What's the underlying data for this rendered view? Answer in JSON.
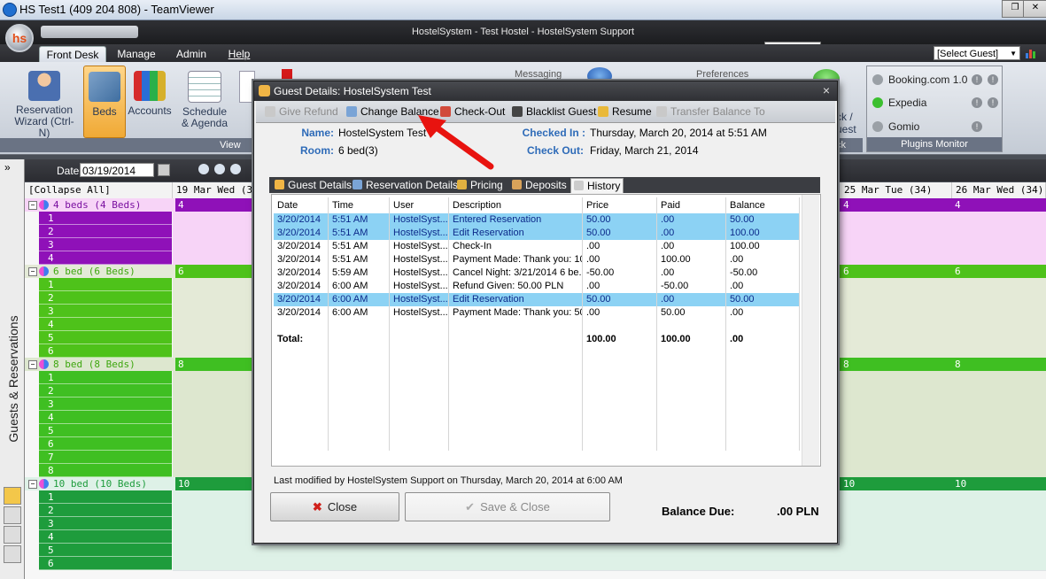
{
  "teamviewer": {
    "title": "HS Test1 (409 204 808) - TeamViewer"
  },
  "app": {
    "title": "HostelSystem - Test Hostel - HostelSystem Support",
    "logo": "hs"
  },
  "menu": {
    "tabs": [
      {
        "label": "Front Desk"
      },
      {
        "label": "Manage"
      },
      {
        "label": "Admin"
      },
      {
        "label": "Help"
      }
    ],
    "select_guest": "[Select Guest]"
  },
  "ribbon": {
    "buttons": [
      {
        "label": "Reservation\nWizard (Ctrl-N)",
        "icon": "person-add-icon"
      },
      {
        "label": "Beds",
        "icon": "beds-icon"
      },
      {
        "label": "Accounts",
        "icon": "binders-icon"
      },
      {
        "label": "Schedule\n& Agenda",
        "icon": "calendar-icon"
      }
    ],
    "group_view": "View",
    "partial": {
      "messaging": "Messaging",
      "preferences": "Preferences",
      "checkout_fragment": "ck /",
      "guest_fragment": "uest",
      "ck_fragment": "ck"
    },
    "plugins_title": "Plugins Monitor",
    "plugins": [
      {
        "name": "Booking.com 1.0",
        "status_color": "#9aa0a6"
      },
      {
        "name": "Expedia",
        "status_color": "#3bbf2f"
      },
      {
        "name": "Gomio",
        "status_color": "#9aa0a6"
      }
    ]
  },
  "sidebar": {
    "label": "Guests & Reservations"
  },
  "datebar": {
    "label": "Date:",
    "value": "03/19/2014"
  },
  "grid": {
    "collapse_label": "[Collapse All]",
    "columns": [
      "19 Mar Wed (34)",
      "25 Mar Tue (34)",
      "26 Mar Wed (34)"
    ],
    "groups": [
      {
        "label": "4 beds (4 Beds)",
        "count": "4",
        "beds": [
          "1",
          "2",
          "3",
          "4"
        ],
        "color": "#8f11b8",
        "cell_color": "#f7d4f7",
        "text_color": "#7a0fa0"
      },
      {
        "label": "6 bed (6 Beds)",
        "count": "6",
        "beds": [
          "1",
          "2",
          "3",
          "4",
          "5",
          "6"
        ],
        "color": "#4ec21a",
        "cell_color": "#e4ead7",
        "text_color": "#3ea70f"
      },
      {
        "label": "8 bed (8 Beds)",
        "count": "8",
        "beds": [
          "1",
          "2",
          "3",
          "4",
          "5",
          "6",
          "7",
          "8"
        ],
        "color": "#3fbf22",
        "cell_color": "#dde7cf",
        "text_color": "#3ea70f"
      },
      {
        "label": "10 bed (10 Beds)",
        "count": "10",
        "beds": [
          "1",
          "2",
          "3",
          "4",
          "5",
          "6"
        ],
        "color": "#1e9c3c",
        "cell_color": "#def1e7",
        "text_color": "#1e9c3c"
      }
    ]
  },
  "dialog": {
    "title": "Guest Details: HostelSystem Test",
    "toolbar": {
      "give_refund": "Give Refund",
      "change_balance": "Change Balance",
      "check_out": "Check-Out",
      "blacklist": "Blacklist Guest",
      "resume": "Resume",
      "transfer": "Transfer Balance To"
    },
    "info": {
      "name_label": "Name:",
      "name_value": "HostelSystem Test",
      "room_label": "Room:",
      "room_value": "6 bed(3)",
      "checkin_label": "Checked In :",
      "checkin_value": "Thursday, March 20, 2014 at 5:51 AM",
      "checkout_label": "Check Out:",
      "checkout_value": "Friday, March 21, 2014"
    },
    "tabs": {
      "guest_details": "Guest Details",
      "reservation_details": "Reservation Details",
      "pricing": "Pricing",
      "deposits": "Deposits",
      "history": "History"
    },
    "history": {
      "headers": [
        "Date",
        "Time",
        "User",
        "Description",
        "Price",
        "Paid",
        "Balance"
      ],
      "rows": [
        {
          "date": "3/20/2014",
          "time": "5:51 AM",
          "user": "HostelSyst...",
          "desc": "Entered Reservation",
          "price": "50.00",
          "paid": ".00",
          "balance": "50.00",
          "selected": true
        },
        {
          "date": "3/20/2014",
          "time": "5:51 AM",
          "user": "HostelSyst...",
          "desc": "Edit Reservation",
          "price": "50.00",
          "paid": ".00",
          "balance": "100.00",
          "selected": true
        },
        {
          "date": "3/20/2014",
          "time": "5:51 AM",
          "user": "HostelSyst...",
          "desc": "Check-In",
          "price": ".00",
          "paid": ".00",
          "balance": "100.00",
          "selected": false
        },
        {
          "date": "3/20/2014",
          "time": "5:51 AM",
          "user": "HostelSyst...",
          "desc": "Payment Made: Thank you: 10...",
          "price": ".00",
          "paid": "100.00",
          "balance": ".00",
          "selected": false
        },
        {
          "date": "3/20/2014",
          "time": "5:59 AM",
          "user": "HostelSyst...",
          "desc": "Cancel Night: 3/21/2014 6 be...",
          "price": "-50.00",
          "paid": ".00",
          "balance": "-50.00",
          "selected": false
        },
        {
          "date": "3/20/2014",
          "time": "6:00 AM",
          "user": "HostelSyst...",
          "desc": "Refund Given: 50.00 PLN",
          "price": ".00",
          "paid": "-50.00",
          "balance": ".00",
          "selected": false
        },
        {
          "date": "3/20/2014",
          "time": "6:00 AM",
          "user": "HostelSyst...",
          "desc": "Edit Reservation",
          "price": "50.00",
          "paid": ".00",
          "balance": "50.00",
          "selected": true
        },
        {
          "date": "3/20/2014",
          "time": "6:00 AM",
          "user": "HostelSyst...",
          "desc": "Payment Made: Thank you: 50...",
          "price": ".00",
          "paid": "50.00",
          "balance": ".00",
          "selected": false
        }
      ],
      "total": {
        "label": "Total:",
        "price": "100.00",
        "paid": "100.00",
        "balance": ".00"
      }
    },
    "last_modified": "Last modified by HostelSystem Support on Thursday, March 20, 2014 at 6:00 AM",
    "close_label": "Close",
    "save_label": "Save & Close",
    "balance_label": "Balance Due:",
    "balance_value": ".00 PLN"
  },
  "colors": {
    "accent_orange": "#f0a935",
    "selection_blue": "#8cd2f4",
    "arrow_red": "#e8130f"
  }
}
